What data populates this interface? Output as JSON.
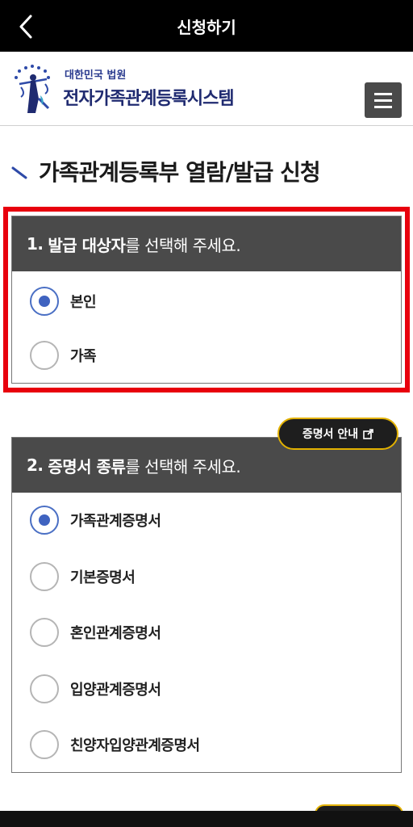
{
  "appbar": {
    "title": "신청하기"
  },
  "header": {
    "org_name": "대한민국 법원",
    "system_name": "전자가족관계등록시스템",
    "emblem_icon": "court-emblem-icon",
    "menu_icon": "hamburger-menu-icon"
  },
  "page": {
    "title": "가족관계등록부 열람/발급 신청"
  },
  "section1": {
    "number": "1.",
    "bold": "발급 대상자",
    "rest": "를 선택해 주세요.",
    "options": [
      {
        "label": "본인",
        "selected": true
      },
      {
        "label": "가족",
        "selected": false
      }
    ]
  },
  "section2": {
    "number": "2.",
    "bold": "증명서 종류",
    "rest": "를 선택해 주세요.",
    "guide_button": "증명서 안내",
    "options": [
      {
        "label": "가족관계증명서",
        "selected": true
      },
      {
        "label": "기본증명서",
        "selected": false
      },
      {
        "label": "혼인관계증명서",
        "selected": false
      },
      {
        "label": "입양관계증명서",
        "selected": false
      },
      {
        "label": "친양자입양관계증명서",
        "selected": false
      }
    ]
  },
  "colors": {
    "highlight": "#e8000d",
    "radio_selected": "#3f63c0",
    "header_bar": "#4a4a4a",
    "brand_navy": "#1f2a70",
    "guide_border": "#e2b100"
  }
}
